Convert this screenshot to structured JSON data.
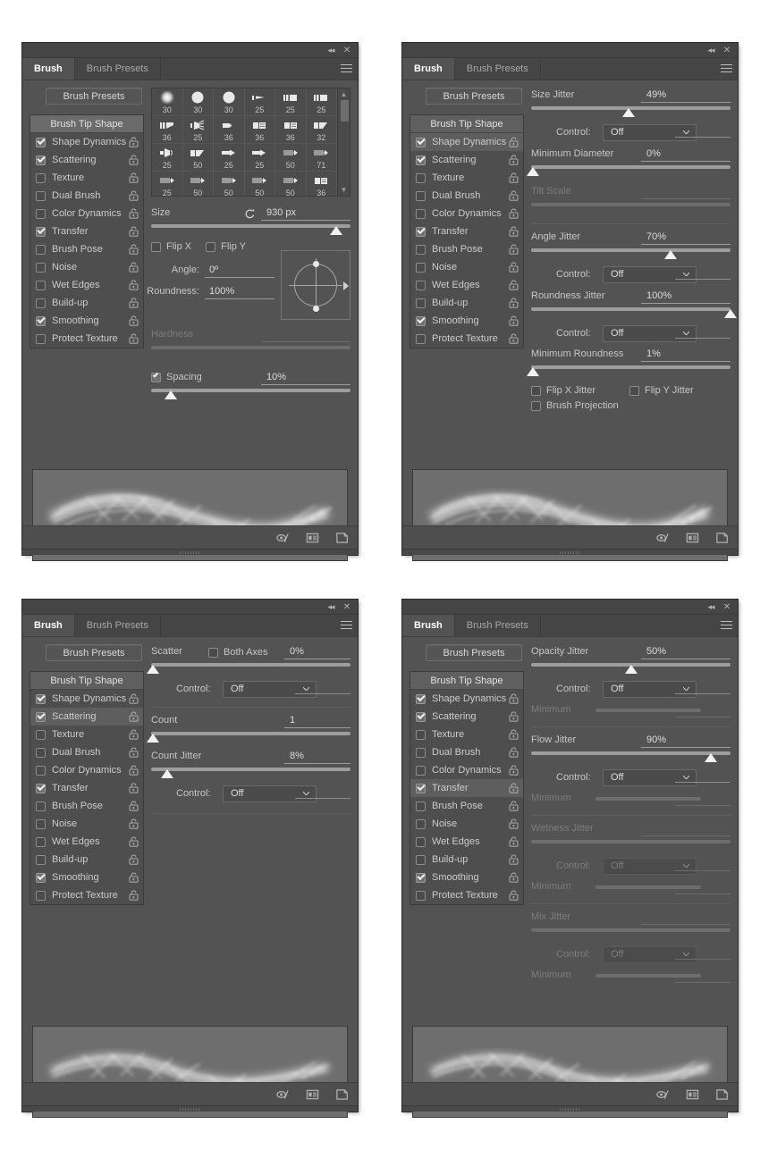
{
  "window": {
    "collapse_icon": "collapse-icon",
    "close_icon": "close-icon",
    "menu_icon": "panel-menu-icon"
  },
  "tabs": {
    "brush": "Brush",
    "presets": "Brush Presets"
  },
  "buttons": {
    "brush_presets": "Brush Presets"
  },
  "options": {
    "header": "Brush Tip Shape",
    "items": [
      {
        "label": "Shape Dynamics",
        "checked": true
      },
      {
        "label": "Scattering",
        "checked": true
      },
      {
        "label": "Texture",
        "checked": false
      },
      {
        "label": "Dual Brush",
        "checked": false
      },
      {
        "label": "Color Dynamics",
        "checked": false
      },
      {
        "label": "Transfer",
        "checked": true
      },
      {
        "label": "Brush Pose",
        "checked": false
      },
      {
        "label": "Noise",
        "checked": false
      },
      {
        "label": "Wet Edges",
        "checked": false
      },
      {
        "label": "Build-up",
        "checked": false
      },
      {
        "label": "Smoothing",
        "checked": true
      },
      {
        "label": "Protect Texture",
        "checked": false
      }
    ]
  },
  "panel1": {
    "selected_option": "Brush Tip Shape",
    "brush_tips": [
      {
        "size": "30",
        "shape": "soft-round"
      },
      {
        "size": "30",
        "shape": "hard-round"
      },
      {
        "size": "30",
        "shape": "hard-round"
      },
      {
        "size": "25",
        "shape": "flat-tip"
      },
      {
        "size": "25",
        "shape": "square-tip"
      },
      {
        "size": "25",
        "shape": "square-tip"
      },
      {
        "size": "36",
        "shape": "angled-tip"
      },
      {
        "size": "25",
        "shape": "fan-tip"
      },
      {
        "size": "36",
        "shape": "round-point"
      },
      {
        "size": "36",
        "shape": "block-tip"
      },
      {
        "size": "36",
        "shape": "block-tip"
      },
      {
        "size": "32",
        "shape": "angled-flat"
      },
      {
        "size": "25",
        "shape": "cone-tip"
      },
      {
        "size": "50",
        "shape": "angled-flat"
      },
      {
        "size": "25",
        "shape": "arrow-tip"
      },
      {
        "size": "25",
        "shape": "arrow-tip"
      },
      {
        "size": "50",
        "shape": "pencil-tip"
      },
      {
        "size": "71",
        "shape": "pencil-tip"
      },
      {
        "size": "25",
        "shape": "pencil-tip"
      },
      {
        "size": "50",
        "shape": "pencil-tip"
      },
      {
        "size": "50",
        "shape": "pencil-tip"
      },
      {
        "size": "50",
        "shape": "pencil-tip"
      },
      {
        "size": "50",
        "shape": "pencil-tip"
      },
      {
        "size": "36",
        "shape": "block-tip"
      }
    ],
    "size": {
      "label": "Size",
      "value": "930 px",
      "reset_icon": "reset-icon",
      "slider_pct": 93
    },
    "flip_x": {
      "label": "Flip X",
      "checked": false
    },
    "flip_y": {
      "label": "Flip Y",
      "checked": false
    },
    "angle": {
      "label": "Angle:",
      "value": "0º"
    },
    "roundness": {
      "label": "Roundness:",
      "value": "100%"
    },
    "hardness": {
      "label": "Hardness",
      "value": ""
    },
    "spacing": {
      "label": "Spacing",
      "checked": true,
      "value": "10%",
      "slider_pct": 10
    }
  },
  "panel2": {
    "selected_option": "Shape Dynamics",
    "size_jitter": {
      "label": "Size Jitter",
      "value": "49%",
      "slider_pct": 49
    },
    "size_control": {
      "label": "Control:",
      "value": "Off"
    },
    "minimum_diameter": {
      "label": "Minimum Diameter",
      "value": "0%",
      "slider_pct": 0
    },
    "tilt_scale": {
      "label": "Tilt Scale",
      "value": ""
    },
    "angle_jitter": {
      "label": "Angle Jitter",
      "value": "70%",
      "slider_pct": 70
    },
    "angle_control": {
      "label": "Control:",
      "value": "Off"
    },
    "roundness_jitter": {
      "label": "Roundness Jitter",
      "value": "100%",
      "slider_pct": 100
    },
    "roundness_control": {
      "label": "Control:",
      "value": "Off"
    },
    "minimum_roundness": {
      "label": "Minimum Roundness",
      "value": "1%",
      "slider_pct": 1
    },
    "flip_x_jitter": {
      "label": "Flip X Jitter",
      "checked": false
    },
    "flip_y_jitter": {
      "label": "Flip Y Jitter",
      "checked": false
    },
    "brush_projection": {
      "label": "Brush Projection",
      "checked": false
    }
  },
  "panel3": {
    "selected_option": "Scattering",
    "scatter": {
      "label": "Scatter",
      "value": "0%",
      "slider_pct": 0
    },
    "both_axes": {
      "label": "Both Axes",
      "checked": false
    },
    "scatter_control": {
      "label": "Control:",
      "value": "Off"
    },
    "count": {
      "label": "Count",
      "value": "1",
      "slider_pct": 0
    },
    "count_jitter": {
      "label": "Count Jitter",
      "value": "8%",
      "slider_pct": 8
    },
    "count_control": {
      "label": "Control:",
      "value": "Off"
    }
  },
  "panel4": {
    "selected_option": "Transfer",
    "opacity_jitter": {
      "label": "Opacity Jitter",
      "value": "50%",
      "slider_pct": 50
    },
    "opacity_control": {
      "label": "Control:",
      "value": "Off"
    },
    "opacity_minimum": {
      "label": "Minimum"
    },
    "flow_jitter": {
      "label": "Flow Jitter",
      "value": "90%",
      "slider_pct": 90
    },
    "flow_control": {
      "label": "Control:",
      "value": "Off"
    },
    "flow_minimum": {
      "label": "Minimum"
    },
    "wetness_jitter": {
      "label": "Wetness Jitter",
      "value": ""
    },
    "wetness_control": {
      "label": "Control:",
      "value": "Off"
    },
    "wetness_minimum": {
      "label": "Minimum"
    },
    "mix_jitter": {
      "label": "Mix Jitter",
      "value": ""
    },
    "mix_control": {
      "label": "Control:",
      "value": "Off"
    },
    "mix_minimum": {
      "label": "Minimum"
    }
  },
  "footer": {
    "toggle_icon": "toggle-brush-settings-icon",
    "new_preset_icon": "create-new-brush-icon",
    "delete_icon": "delete-brush-icon"
  },
  "colors": {
    "panel_bg": "#535353",
    "titlebar_bg": "#454545",
    "selected_row": "#5e5e6e",
    "text": "#c8c8c8",
    "dim_text": "#7c7c7c",
    "slider_track": "#9d9d9d",
    "preview_bg": "#6e6e6e"
  }
}
